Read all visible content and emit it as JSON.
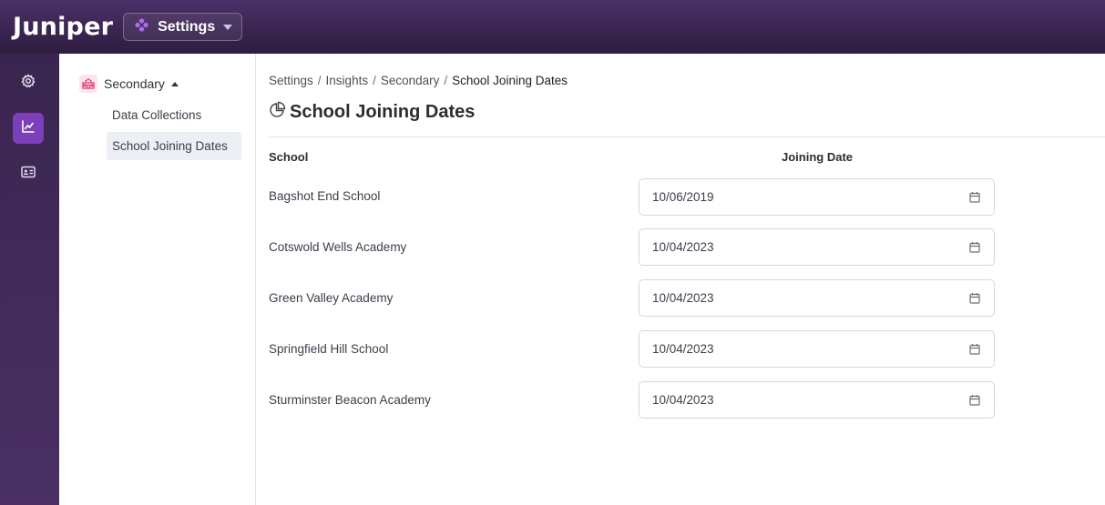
{
  "header": {
    "logo": "Juniper",
    "app_switcher": {
      "label": "Settings",
      "icon": "apps-icon"
    }
  },
  "rail": {
    "items": [
      {
        "name": "settings",
        "icon": "gear-icon",
        "active": false
      },
      {
        "name": "insights",
        "icon": "chart-icon",
        "active": true
      },
      {
        "name": "contacts",
        "icon": "id-card-icon",
        "active": false
      }
    ]
  },
  "subnav": {
    "group": {
      "label": "Secondary",
      "icon": "school-icon",
      "expanded": true
    },
    "items": [
      {
        "label": "Data Collections",
        "selected": false
      },
      {
        "label": "School Joining Dates",
        "selected": true
      }
    ]
  },
  "breadcrumb": {
    "items": [
      "Settings",
      "Insights",
      "Secondary"
    ],
    "current": "School Joining Dates"
  },
  "page": {
    "title": "School Joining Dates",
    "title_icon": "pie-chart-icon"
  },
  "table": {
    "headers": {
      "school": "School",
      "joining_date": "Joining Date"
    },
    "rows": [
      {
        "school": "Bagshot End School",
        "date": "10/06/2019"
      },
      {
        "school": "Cotswold Wells Academy",
        "date": "10/04/2023"
      },
      {
        "school": "Green Valley Academy",
        "date": "10/04/2023"
      },
      {
        "school": "Springfield Hill School",
        "date": "10/04/2023"
      },
      {
        "school": "Sturminster Beacon Academy",
        "date": "10/04/2023"
      }
    ]
  },
  "colors": {
    "header_bg": "#3d2755",
    "rail_bg": "#3f2858",
    "active_accent": "#7b3fb8",
    "selected_item_bg": "#eceff4"
  }
}
